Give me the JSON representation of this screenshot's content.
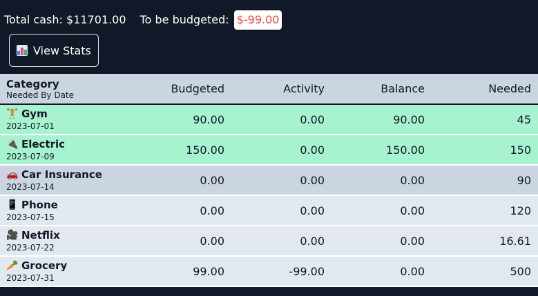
{
  "header": {
    "total_cash_label": "Total cash:",
    "total_cash_value": "$11701.00",
    "to_be_budgeted_label": "To be budgeted:",
    "to_be_budgeted_value": "$-99.00",
    "view_stats_label": "View Stats"
  },
  "table": {
    "headers": {
      "category": "Category",
      "category_sub": "Needed By Date",
      "budgeted": "Budgeted",
      "activity": "Activity",
      "balance": "Balance",
      "needed": "Needed"
    },
    "rows": [
      {
        "icon": "🏋",
        "name": "Gym",
        "date": "2023-07-01",
        "budgeted": "90.00",
        "activity": "0.00",
        "balance": "90.00",
        "needed": "45"
      },
      {
        "icon": "🔌",
        "name": "Electric",
        "date": "2023-07-09",
        "budgeted": "150.00",
        "activity": "0.00",
        "balance": "150.00",
        "needed": "150"
      },
      {
        "icon": "🚗",
        "name": "Car Insurance",
        "date": "2023-07-14",
        "budgeted": "0.00",
        "activity": "0.00",
        "balance": "0.00",
        "needed": "90"
      },
      {
        "icon": "📱",
        "name": "Phone",
        "date": "2023-07-15",
        "budgeted": "0.00",
        "activity": "0.00",
        "balance": "0.00",
        "needed": "120"
      },
      {
        "icon": "🎥",
        "name": "Netflix",
        "date": "2023-07-22",
        "budgeted": "0.00",
        "activity": "0.00",
        "balance": "0.00",
        "needed": "16.61"
      },
      {
        "icon": "🥕",
        "name": "Grocery",
        "date": "2023-07-31",
        "budgeted": "99.00",
        "activity": "-99.00",
        "balance": "0.00",
        "needed": "500"
      }
    ]
  },
  "colors": {
    "background": "#111827",
    "funded_row": "#a7f3d0",
    "unfunded_row_a": "#cbd5e1",
    "unfunded_row_b": "#e2e8f0",
    "negative": "#ef4444"
  }
}
